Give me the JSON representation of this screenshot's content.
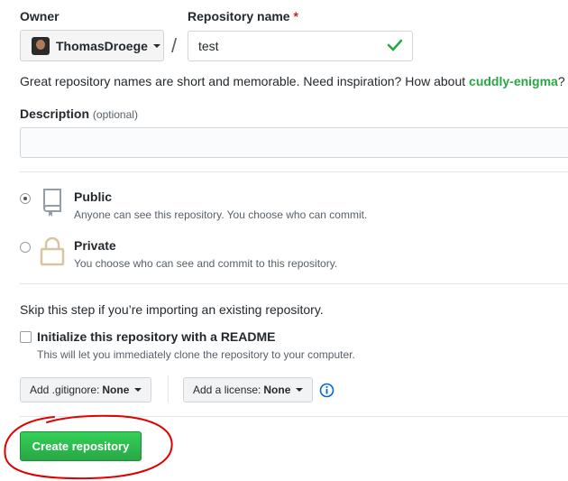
{
  "owner": {
    "label": "Owner",
    "value": "ThomasDroege"
  },
  "repo_name": {
    "label": "Repository name",
    "required_mark": "*",
    "value": "test",
    "separator": "/"
  },
  "name_hint": {
    "text": "Great repository names are short and memorable. Need inspiration? How about ",
    "suggestion": "cuddly-enigma",
    "end": "?"
  },
  "description": {
    "label": "Description",
    "optional": "(optional)",
    "value": ""
  },
  "visibility": {
    "public": {
      "title": "Public",
      "desc": "Anyone can see this repository. You choose who can commit.",
      "selected": true
    },
    "private": {
      "title": "Private",
      "desc": "You choose who can see and commit to this repository.",
      "selected": false
    }
  },
  "init": {
    "skip_text": "Skip this step if you’re importing an existing repository.",
    "readme_label": "Initialize this repository with a README",
    "readme_desc": "This will let you immediately clone the repository to your computer.",
    "readme_checked": false
  },
  "gitignore": {
    "label": "Add .gitignore:",
    "value": "None"
  },
  "license": {
    "label": "Add a license:",
    "value": "None"
  },
  "create_button": "Create repository",
  "colors": {
    "accent_green": "#28a745",
    "annotation_red": "#e00000",
    "info_blue": "#0366d6"
  }
}
